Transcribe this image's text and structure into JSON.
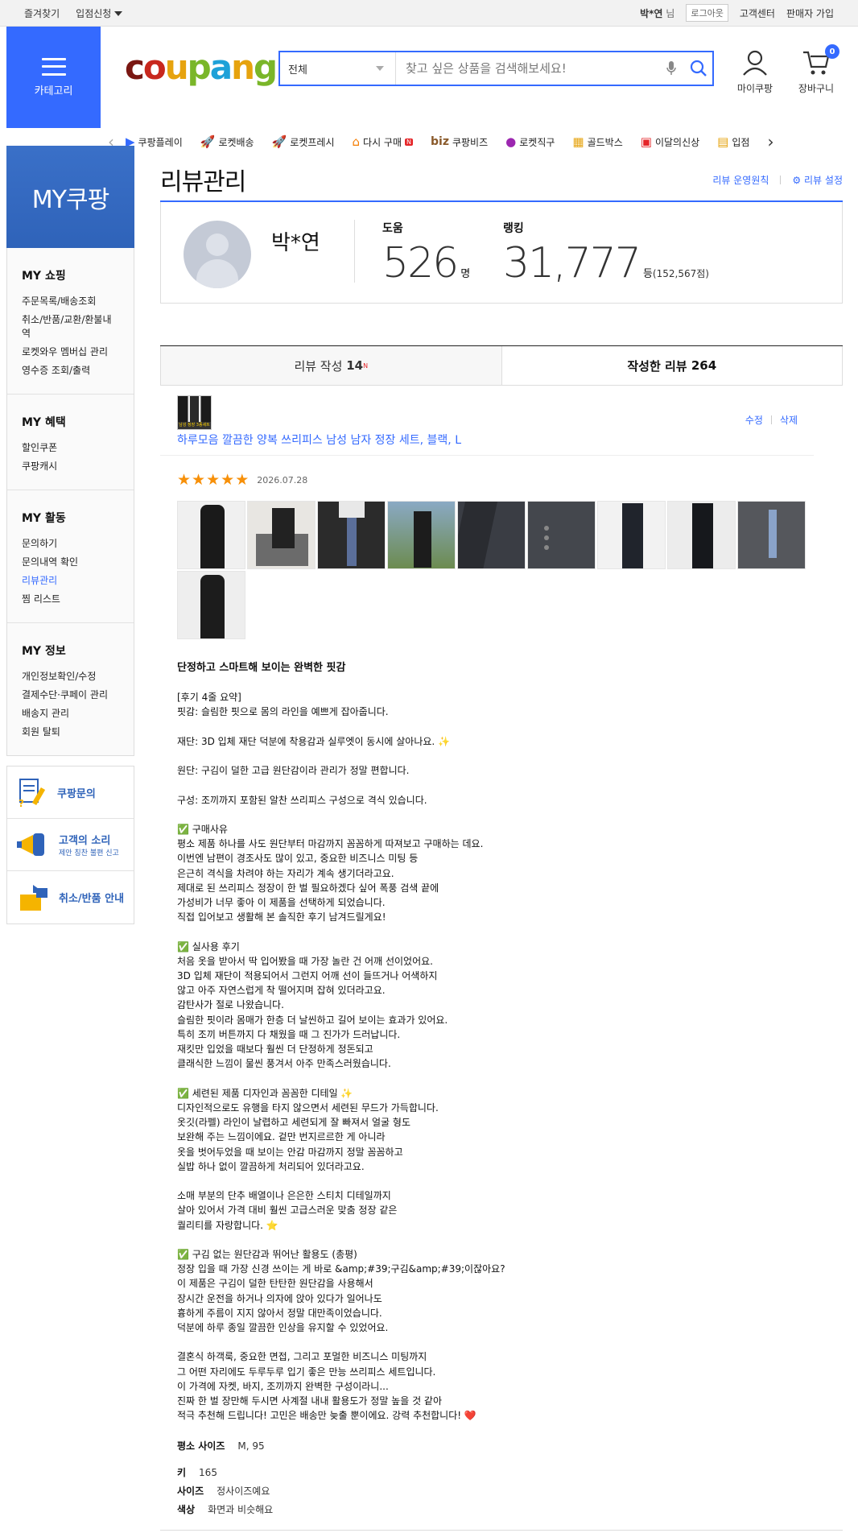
{
  "topbar": {
    "favorites": "즐겨찾기",
    "partner": "입점신청",
    "user_name": "박*연",
    "user_suffix": "님",
    "logout": "로그아웃",
    "customer_center": "고객센터",
    "seller_join": "판매자 가입"
  },
  "header": {
    "category_label": "카테고리",
    "search_select": "전체",
    "search_placeholder": "찾고 싶은 상품을 검색해보세요!",
    "mypage": "마이쿠팡",
    "cart": "장바구니",
    "cart_count": "0",
    "categories": [
      "쿠팡플레이",
      "로켓배송",
      "로켓프레시",
      "다시 구매",
      "쿠팡비즈",
      "로켓직구",
      "골드박스",
      "이달의신상",
      "입점"
    ]
  },
  "sidebar": {
    "my_title": "MY쿠팡",
    "sections": [
      {
        "title": "MY 쇼핑",
        "items": [
          "주문목록/배송조회",
          "취소/반품/교환/환불내역",
          "로켓와우 멤버십 관리",
          "영수증 조회/출력"
        ]
      },
      {
        "title": "MY 혜택",
        "items": [
          "할인쿠폰",
          "쿠팡캐시"
        ]
      },
      {
        "title": "MY 활동",
        "items": [
          "문의하기",
          "문의내역 확인",
          "리뷰관리",
          "찜 리스트"
        ]
      },
      {
        "title": "MY 정보",
        "items": [
          "개인정보확인/수정",
          "결제수단·쿠페이 관리",
          "배송지 관리",
          "회원 탈퇴"
        ]
      }
    ],
    "cs": [
      {
        "label": "쿠팡문의",
        "sub": ""
      },
      {
        "label": "고객의 소리",
        "sub": "제안 칭찬 불편 신고"
      },
      {
        "label": "취소/반품 안내",
        "sub": ""
      }
    ]
  },
  "main": {
    "title": "리뷰관리",
    "policy_link": "리뷰 운영원칙",
    "settings_link": "리뷰 설정",
    "profile": {
      "name": "박*연",
      "help_label": "도움",
      "help_count": "526",
      "help_unit": "명",
      "rank_label": "랭킹",
      "rank": "31,777",
      "rank_unit": "등",
      "rank_points": "(152,567점)"
    },
    "tabs": {
      "write_label": "리뷰 작성",
      "write_count": "14",
      "write_new": "N",
      "written_label": "작성한 리뷰",
      "written_count": "264"
    },
    "product": {
      "thumb_tag": "남성 정장 3종세트",
      "name": "하루모음 깔끔한 양복 쓰리피스 남성 남자 정장 세트, 블랙, L",
      "edit": "수정",
      "delete": "삭제"
    },
    "review": {
      "stars": 5,
      "date": "2026.07.28",
      "headline": "단정하고 스마트해 보이는 완벽한 핏감",
      "body": "[후기 4줄 요약]\n핏감: 슬림한 핏으로 몸의 라인을 예쁘게 잡아줍니다.\n\n재단: 3D 입체 재단 덕분에 착용감과 실루엣이 동시에 살아나요. ✨\n\n원단: 구김이 덜한 고급 원단감이라 관리가 정말 편합니다.\n\n구성: 조끼까지 포함된 알찬 쓰리피스 구성으로 격식 있습니다.\n\n✅ 구매사유\n평소 제품 하나를 사도 원단부터 마감까지 꼼꼼하게 따져보고 구매하는 데요.\n이번엔 남편이 경조사도 많이 있고, 중요한 비즈니스 미팅 등\n은근히 격식을 차려야 하는 자리가 계속 생기더라고요.\n제대로 된 쓰리피스 정장이 한 벌 필요하겠다 싶어 폭풍 검색 끝에\n가성비가 너무 좋아 이 제품을 선택하게 되었습니다.\n직접 입어보고 생활해 본 솔직한 후기 남겨드릴게요!\n\n✅ 실사용 후기\n처음 옷을 받아서 딱 입어봤을 때 가장 놀란 건 어깨 선이었어요.\n3D 입체 재단이 적용되어서 그런지 어깨 선이 들뜨거나 어색하지\n않고 아주 자연스럽게 착 떨어지며 잡혀 있더라고요.\n감탄사가 절로 나왔습니다.\n슬림한 핏이라 몸매가 한층 더 날씬하고 길어 보이는 효과가 있어요.\n특히 조끼 버튼까지 다 채웠을 때 그 진가가 드러납니다.\n재킷만 입었을 때보다 훨씬 더 단정하게 정돈되고\n클래식한 느낌이 물씬 풍겨서 아주 만족스러웠습니다.\n\n✅ 세련된 제품 디자인과 꼼꼼한 디테일 ✨\n디자인적으로도 유행을 타지 않으면서 세련된 무드가 가득합니다.\n옷깃(라펠) 라인이 날렵하고 세련되게 잘 빠져서 얼굴 형도\n보완해 주는 느낌이에요. 겉만 번지르르한 게 아니라\n옷을 벗어두었을 때 보이는 안감 마감까지 정말 꼼꼼하고\n실밥 하나 없이 깔끔하게 처리되어 있더라고요.\n\n소매 부분의 단추 배열이나 은은한 스티치 디테일까지\n살아 있어서 가격 대비 훨씬 고급스러운 맞춤 정장 같은\n퀄리티를 자랑합니다. ⭐\n\n✅ 구김 없는 원단감과 뛰어난 활용도 (총평)\n정장 입을 때 가장 신경 쓰이는 게 바로 &amp;#39;구김&amp;#39;이잖아요?\n이 제품은 구김이 덜한 탄탄한 원단감을 사용해서\n장시간 운전을 하거나 의자에 앉아 있다가 일어나도\n흉하게 주름이 지지 않아서 정말 대만족이었습니다.\n덕분에 하루 종일 깔끔한 인상을 유지할 수 있었어요.\n\n결혼식 하객룩, 중요한 면접, 그리고 포멀한 비즈니스 미팅까지\n그 어떤 자리에도 두루두루 입기 좋은 만능 쓰리피스 세트입니다.\n이 가격에 자켓, 바지, 조끼까지 완벽한 구성이라니...\n진짜 한 벌 장만해 두시면 사계절 내내 활용도가 정말 높을 것 같아\n적극 추천해 드립니다! 고민은 배송만 늦출 뿐이에요. 강력 추천합니다! ❤️",
      "usual_size_label": "평소 사이즈",
      "usual_size": "M, 95",
      "height_label": "키",
      "height": "165",
      "size_label": "사이즈",
      "size_value": "정사이즈예요",
      "color_label": "색상",
      "color_value": "화면과 비슷해요"
    }
  },
  "colors": {
    "brand_blue": "#346aff",
    "star": "#f79009",
    "new_badge": "#e52528"
  }
}
